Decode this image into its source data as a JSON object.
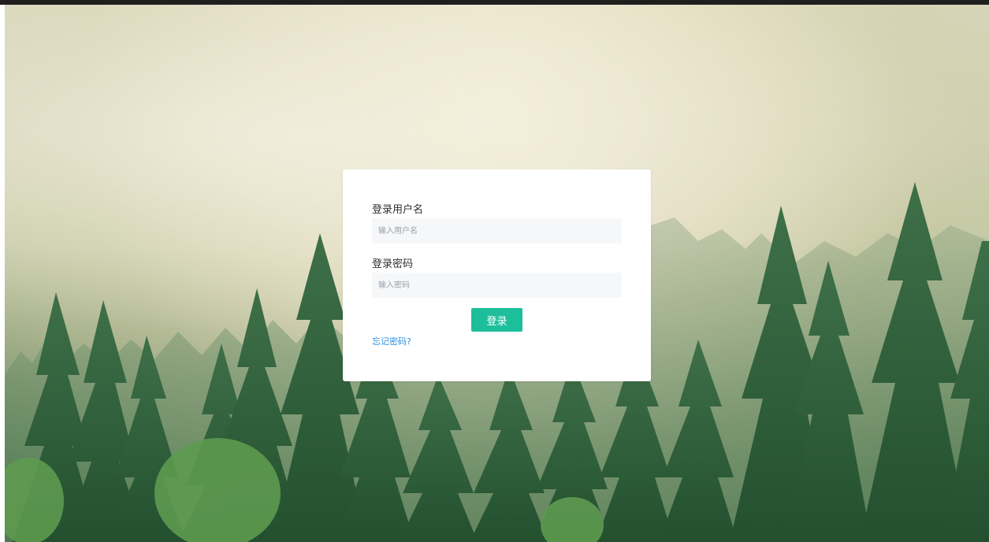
{
  "login": {
    "username_label": "登录用户名",
    "username_placeholder": "输入用户名",
    "username_value": "",
    "password_label": "登录密码",
    "password_placeholder": "输入密码",
    "password_value": "",
    "submit_label": "登录",
    "forgot_label": "忘记密码?"
  },
  "colors": {
    "accent": "#1dbf9a",
    "link": "#2f8fe0",
    "input_bg": "#f6f7f9"
  }
}
